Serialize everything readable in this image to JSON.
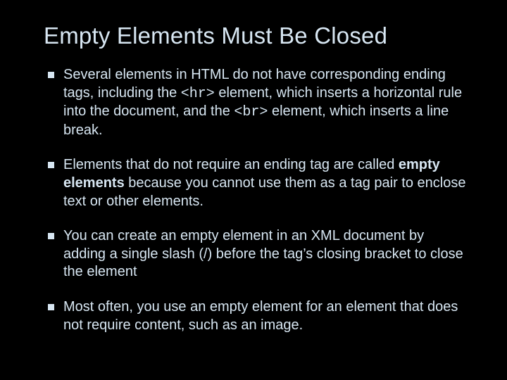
{
  "title": "Empty Elements Must Be Closed",
  "bullets": [
    {
      "p1": "Several elements in HTML do not have corresponding ending tags, including the ",
      "c1": "<hr>",
      "p2": " element, which inserts a horizontal rule into the document, and the ",
      "c2": "<br>",
      "p3": " element, which inserts a line break."
    },
    {
      "p1": "Elements that do not require an ending tag are called ",
      "b1": "empty elements",
      "p2": " because you cannot use them as a tag pair to enclose text or other elements."
    },
    {
      "p1": "You can create an empty element in an XML document by adding a single slash (/) before the tag’s closing bracket to close the element"
    },
    {
      "p1": "Most often, you use an empty element for an element that does not require content, such as an image."
    }
  ]
}
